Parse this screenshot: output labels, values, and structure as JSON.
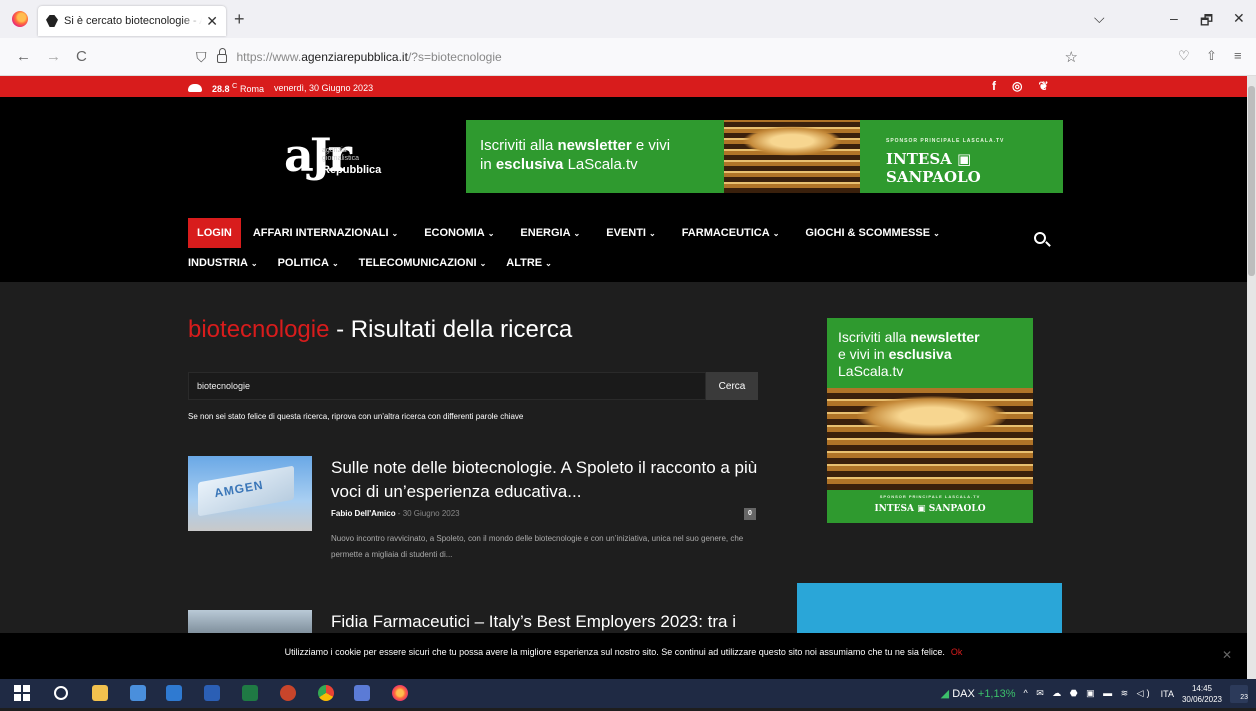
{
  "browser": {
    "tab_title": "Si è cercato biotecnologie - Ag",
    "tab_close": "✕",
    "new_tab": "+",
    "url_prefix": "https://www.",
    "url_domain": "agenziarepubblica.it",
    "url_path": "/?s=biotecnologie",
    "btn_back": "←",
    "btn_forward": "→",
    "btn_reload": "C",
    "btn_bookmark": "☆",
    "win_tabs_list": "⌵",
    "win_min": "–",
    "win_restore": "🗗",
    "win_close": "✕",
    "pocket": "♡",
    "share": "⇧",
    "menu": "≡"
  },
  "topbar": {
    "temperature": "28.8",
    "temp_unit": "C",
    "city": "Roma",
    "date": "venerdì, 30 Giugno 2023",
    "social": [
      "f",
      "◎",
      "❦"
    ]
  },
  "logo": {
    "big": "aJr",
    "sub1": "agenzia",
    "sub2": "giornalistica",
    "rep": "Repubblica"
  },
  "banner": {
    "line1_pre": "Iscriviti alla ",
    "line1_bold": "newsletter",
    "line1_post": " e vivi",
    "line2_pre": "in ",
    "line2_bold": "esclusiva",
    "line2_post": " LaScala.tv",
    "sponsor": "SPONSOR PRINCIPALE LASCALA.TV",
    "bank": "INTESA ▣ SANPAOLO"
  },
  "menu": {
    "login": "LOGIN",
    "row1": [
      "AFFARI INTERNAZIONALI",
      "ECONOMIA",
      "ENERGIA",
      "EVENTI",
      "FARMACEUTICA",
      "GIOCHI & SCOMMESSE"
    ],
    "row2": [
      "INDUSTRIA",
      "POLITICA",
      "TELECOMUNICAZIONI",
      "ALTRE"
    ],
    "chevron": "⌄"
  },
  "search": {
    "keyword": "biotecnologie",
    "title_rest": " - Risultati della ricerca",
    "input_value": "biotecnologie",
    "button": "Cerca",
    "hint": "Se non sei stato felice di questa ricerca, riprova con un'altra ricerca con differenti parole chiave"
  },
  "articles": [
    {
      "title": "Sulle note delle biotecnologie. A Spoleto il racconto a più voci di un’esperienza educativa...",
      "author": "Fabio Dell'Amico",
      "sep": " - ",
      "date": "30 Giugno 2023",
      "comments": "0",
      "excerpt": "Nuovo incontro ravvicinato, a Spoleto, con il mondo delle biotecnologie e con un’iniziativa, unica nel suo genere, che permette a migliaia di studenti di...",
      "thumb_text": "AMGEN"
    },
    {
      "title": "Fidia Farmaceutici – Italy’s Best Employers 2023: tra i"
    }
  ],
  "side_ad": {
    "line1_pre": "Iscriviti alla ",
    "line1_bold": "newsletter",
    "line2_pre": "e vivi in ",
    "line2_bold": "esclusiva",
    "line3": "LaScala.tv",
    "sponsor": "SPONSOR PRINCIPALE LASCALA.TV",
    "bank": "INTESA ▣ SANPAOLO"
  },
  "cookie": {
    "text": "Utilizziamo i cookie per essere sicuri che tu possa avere la migliore esperienza sul nostro sito. Se continui ad utilizzare questo sito noi assumiamo che tu ne sia felice.",
    "ok": "Ok",
    "close": "✕"
  },
  "taskbar": {
    "dax_label": "DAX",
    "dax_change": "+1,13%",
    "sys_icons": "^ ✉ ☁ ⬣ ▣ ▬ ≋ ◁)",
    "lang": "ITA",
    "time": "14:45",
    "date": "30/06/2023",
    "notif_count": "23",
    "apps": [
      "file-explorer-icon",
      "store-icon",
      "mail-icon",
      "word-icon",
      "excel-icon",
      "powerpoint-icon",
      "chrome-icon",
      "teams-icon",
      "firefox-icon"
    ]
  },
  "colors": {
    "accent_red": "#d81c1c",
    "ad_green": "#2f9a2f",
    "page_bg": "#1e1e1e"
  }
}
